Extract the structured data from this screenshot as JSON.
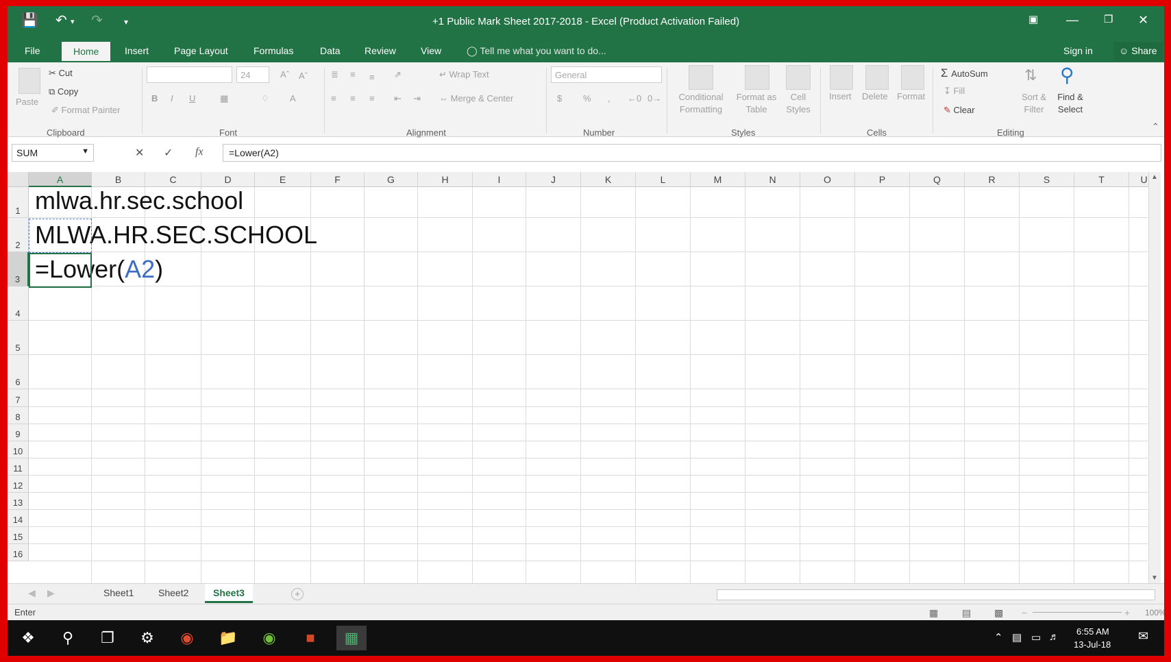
{
  "window": {
    "title": "+1 Public Mark Sheet 2017-2018 - Excel (Product Activation Failed)",
    "accent_color": "#217346"
  },
  "quick_access": {
    "save_icon": "save-icon",
    "undo_icon": "undo-icon",
    "redo_icon": "redo-icon"
  },
  "tabs": [
    "File",
    "Home",
    "Insert",
    "Page Layout",
    "Formulas",
    "Data",
    "Review",
    "View"
  ],
  "tell_me": "Tell me what you want to do...",
  "sign_in": "Sign in",
  "share": "Share",
  "ribbon": {
    "clipboard": {
      "paste": "Paste",
      "cut": "Cut",
      "copy": "Copy",
      "format_painter": "Format Painter",
      "label": "Clipboard"
    },
    "font": {
      "font_name": "",
      "font_size": "24",
      "bold": "B",
      "italic": "I",
      "underline": "U",
      "label": "Font"
    },
    "alignment": {
      "wrap_text": "Wrap Text",
      "merge_center": "Merge & Center",
      "label": "Alignment"
    },
    "number": {
      "format": "General",
      "currency": "$",
      "percent": "%",
      "label": "Number"
    },
    "styles": {
      "conditional": [
        "Conditional",
        "Formatting"
      ],
      "format_table": [
        "Format as",
        "Table"
      ],
      "cell_styles": [
        "Cell",
        "Styles"
      ],
      "label": "Styles"
    },
    "cells": {
      "insert": "Insert",
      "delete": "Delete",
      "format": "Format",
      "label": "Cells"
    },
    "editing": {
      "autosum": "AutoSum",
      "fill": "Fill",
      "clear": "Clear",
      "sort_filter": [
        "Sort &",
        "Filter"
      ],
      "find_select": [
        "Find &",
        "Select"
      ],
      "label": "Editing"
    }
  },
  "formula_bar": {
    "name_box": "SUM",
    "formula": "=Lower(A2)",
    "fx": "fx"
  },
  "grid": {
    "columns": [
      "A",
      "B",
      "C",
      "D",
      "E",
      "F",
      "G",
      "H",
      "I",
      "J",
      "K",
      "L",
      "M",
      "N",
      "O",
      "P",
      "Q",
      "R",
      "S",
      "T",
      "U"
    ],
    "rows": [
      "1",
      "2",
      "3",
      "4",
      "5",
      "6",
      "7",
      "8",
      "9",
      "10",
      "11",
      "12",
      "13",
      "14",
      "15",
      "16"
    ],
    "cells": {
      "a1": "mlwa.hr.sec.school",
      "a2": "MLWA.HR.SEC.SCHOOL",
      "a3_prefix": "=Lower(",
      "a3_ref": "A2",
      "a3_suffix": ")"
    }
  },
  "sheets": [
    "Sheet1",
    "Sheet2",
    "Sheet3"
  ],
  "active_sheet": "Sheet3",
  "status": {
    "mode": "Enter",
    "zoom": "100%"
  },
  "taskbar": {
    "time": "6:55 AM",
    "date": "13-Jul-18",
    "icons": [
      "windows-start-icon",
      "search-icon",
      "task-view-icon",
      "settings-icon",
      "chrome-icon",
      "file-explorer-icon",
      "utorrent-icon",
      "powerpoint-icon",
      "excel-icon"
    ]
  }
}
